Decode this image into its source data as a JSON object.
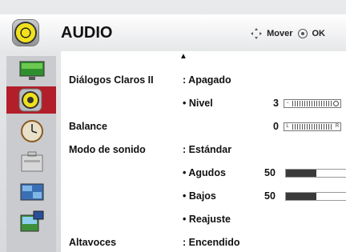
{
  "header": {
    "title": "AUDIO",
    "move_label": "Mover",
    "ok_label": "OK"
  },
  "sidebar": {
    "items": [
      {
        "icon": "monitor-icon"
      },
      {
        "icon": "audio-icon",
        "active": true
      },
      {
        "icon": "clock-icon"
      },
      {
        "icon": "toolbox-icon"
      },
      {
        "icon": "picture-icon"
      },
      {
        "icon": "input-icon"
      }
    ]
  },
  "menu": {
    "dialog_label": "Diálogos Claros II",
    "dialog_value": ": Apagado",
    "level_label": "• Nivel",
    "level_value": "3",
    "balance_label": "Balance",
    "balance_value": "0",
    "balance_left": "L",
    "balance_right": "R",
    "sound_mode_label": "Modo de sonido",
    "sound_mode_value": ": Estándar",
    "treble_label": "• Agudos",
    "treble_value": "50",
    "treble_level": 0.5,
    "bass_label": "• Bajos",
    "bass_value": "50",
    "bass_level": 0.5,
    "reset_label": "• Reajuste",
    "speakers_label": "Altavoces",
    "speakers_value": ": Encendido"
  }
}
